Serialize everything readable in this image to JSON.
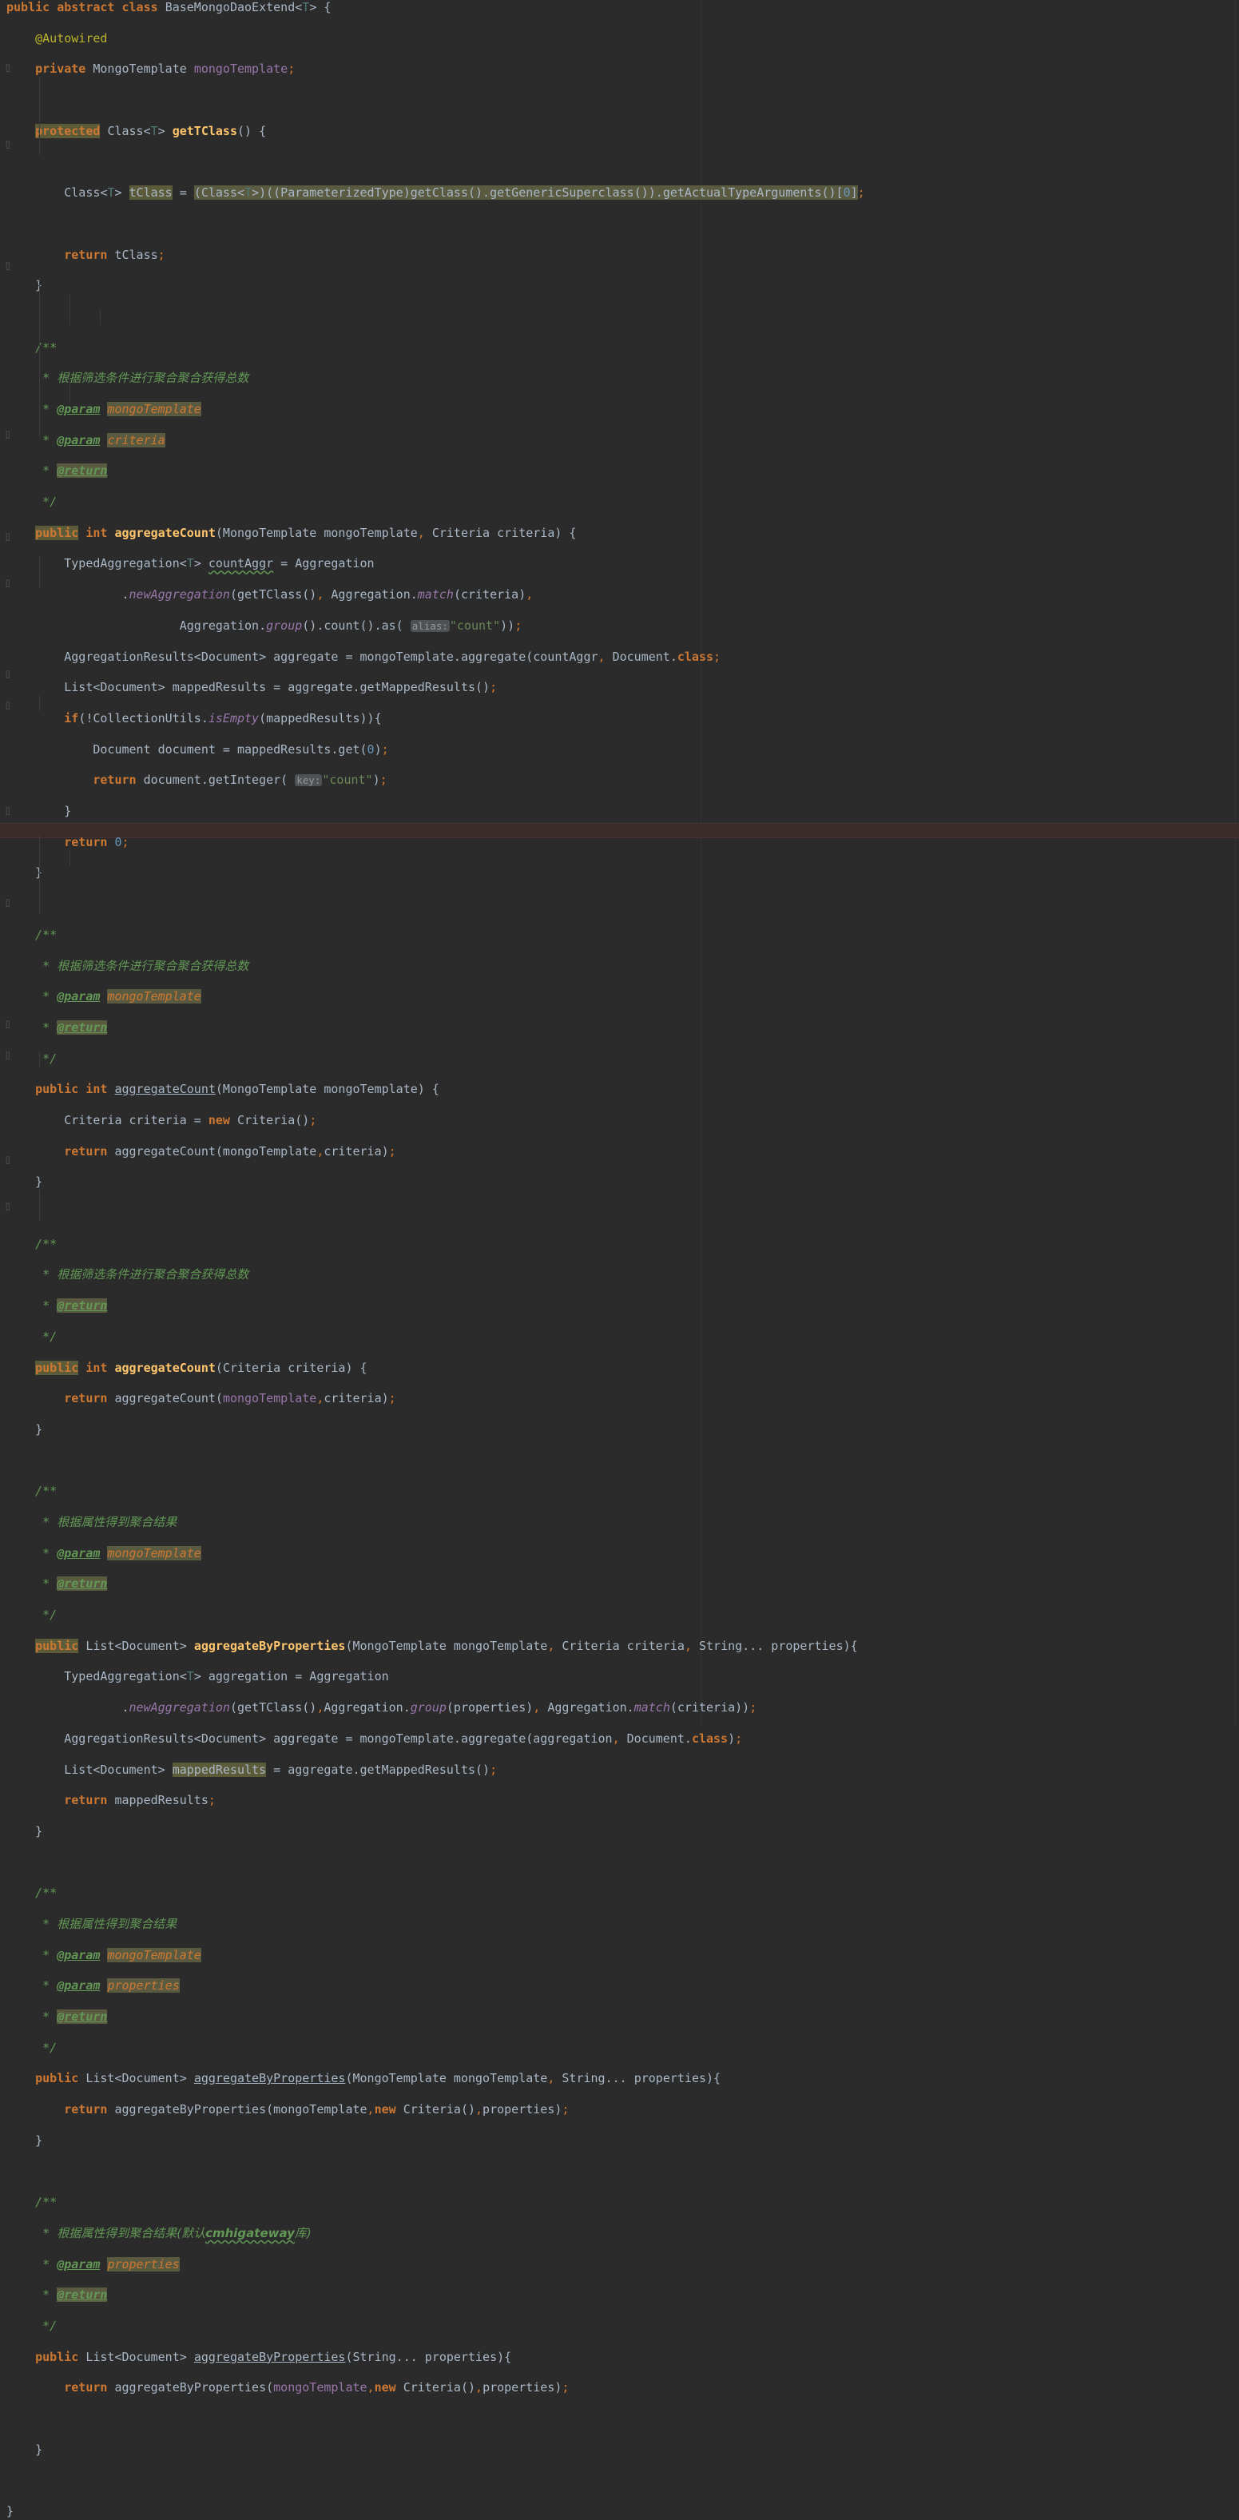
{
  "app": {
    "kind": "code-editor",
    "theme": "darcula",
    "language": "Java",
    "class_name": "BaseMongoDaoExtend"
  },
  "colors": {
    "background": "#2b2b2b",
    "foreground": "#a9b7c6",
    "keyword": "#cc7832",
    "string": "#6a8759",
    "number": "#6897bb",
    "comment": "#629755",
    "annotation": "#bbb529",
    "method_name": "#ffc66d",
    "field": "#9876aa",
    "generic": "#507874",
    "caret_line": "#3a2b2b",
    "identifier_highlight": "#5c5b39",
    "param_hint_bg": "#4e5254",
    "param_hint_fg": "#969696"
  },
  "gutter": {
    "fold_marker": "⌷",
    "fold_rows": [
      86,
      182,
      334,
      545,
      673,
      731,
      845,
      884,
      1016,
      1131,
      1283,
      1322,
      1453,
      1511
    ]
  },
  "hints": {
    "alias": "alias:",
    "key": "key:"
  },
  "code": {
    "lines": [
      "public abstract class BaseMongoDaoExtend<T> {",
      "    @Autowired",
      "    private MongoTemplate mongoTemplate;",
      "",
      "    protected Class<T> getTClass() {",
      "",
      "        Class<T> tClass = (Class<T>)((ParameterizedType)getClass().getGenericSuperclass()).getActualTypeArguments()[0];",
      "",
      "        return tClass;",
      "    }",
      "",
      "    /**",
      "     * 根据筛选条件进行聚合聚合获得总数",
      "     * @param mongoTemplate",
      "     * @param criteria",
      "     * @return",
      "     */",
      "    public int aggregateCount(MongoTemplate mongoTemplate, Criteria criteria) {",
      "        TypedAggregation<T> countAggr = Aggregation",
      "                .newAggregation(getTClass(), Aggregation.match(criteria),",
      "                        Aggregation.group().count().as( alias: \"count\"));",
      "        AggregationResults<Document> aggregate = mongoTemplate.aggregate(countAggr, Document.class);",
      "        List<Document> mappedResults = aggregate.getMappedResults();",
      "        if(!CollectionUtils.isEmpty(mappedResults)){",
      "            Document document = mappedResults.get(0);",
      "            return document.getInteger( key: \"count\");",
      "        }",
      "        return 0;",
      "    }",
      "",
      "    /**",
      "     * 根据筛选条件进行聚合聚合获得总数",
      "     * @param mongoTemplate",
      "     * @return",
      "     */",
      "    public int aggregateCount(MongoTemplate mongoTemplate) {",
      "        Criteria criteria = new Criteria();",
      "        return aggregateCount(mongoTemplate,criteria);",
      "    }",
      "",
      "    /**",
      "     * 根据筛选条件进行聚合聚合获得总数",
      "     * @return",
      "     */",
      "    public int aggregateCount(Criteria criteria) {",
      "        return aggregateCount(mongoTemplate,criteria);",
      "    }",
      "",
      "    /**",
      "     * 根据属性得到聚合结果",
      "     * @param mongoTemplate",
      "     * @return",
      "     */",
      "    public List<Document> aggregateByProperties(MongoTemplate mongoTemplate, Criteria criteria, String... properties){",
      "        TypedAggregation<T> aggregation = Aggregation",
      "                .newAggregation(getTClass(),Aggregation.group(properties), Aggregation.match(criteria));",
      "        AggregationResults<Document> aggregate = mongoTemplate.aggregate(aggregation, Document.class);",
      "        List<Document> mappedResults = aggregate.getMappedResults();",
      "        return mappedResults;",
      "    }",
      "",
      "    /**",
      "     * 根据属性得到聚合结果",
      "     * @param mongoTemplate",
      "     * @param properties",
      "     * @return",
      "     */",
      "    public List<Document> aggregateByProperties(MongoTemplate mongoTemplate, String... properties){",
      "        return aggregateByProperties(mongoTemplate,new Criteria(),properties);",
      "    }",
      "",
      "    /**",
      "     * 根据属性得到聚合结果(默认cmhigateway库)",
      "     * @param properties",
      "     * @return",
      "     */",
      "    public List<Document> aggregateByProperties(String... properties){",
      "        return aggregateByProperties(mongoTemplate,new Criteria(),properties);",
      "",
      "    }",
      "",
      "}"
    ],
    "caret_line_index": 53,
    "caret_line_text": "        TypedAggregation<T> aggregation = Aggregation"
  }
}
